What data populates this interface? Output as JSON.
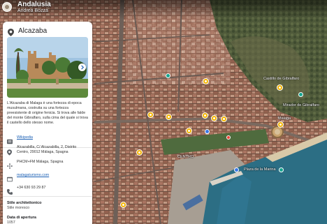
{
  "header": {
    "title": "Andalusia",
    "subtitle": "Andrea Bozza"
  },
  "panel": {
    "place_icon": "location-pin-icon",
    "title": "Alcazaba",
    "description": "L'Alcazaba di Malaga è una fortezza di epoca musulmana, costruita su una fortezza preesistente di origine fenicia. Si trova alle falde del monte Gibralfaro, sulla cima del quale si trova il castello dello stesso nome.",
    "wikipedia_label": "Wikipedia",
    "address": "Alcazabilla, C/ Alcazabilla, 2, Distrito Centro, 29012 Málaga, Spagna",
    "plus_code": "PHCM+FM Málaga, Spagna",
    "website": "malagaturismo.com",
    "phone": "+34 630 93 29 87",
    "style_label": "Stile architettonico",
    "style_value": "Stile moresco",
    "opening_label": "Data di apertura",
    "opening_value": "1057"
  },
  "map": {
    "labels": {
      "castillo": "Castillo de Gibralfaro",
      "mirador": "Mirador de Gibralfaro",
      "centro": "CENTRO",
      "plaza": "Plaza de la Marina",
      "malaga_port": "Málaga"
    },
    "colors": {
      "pin": "#f4b400",
      "green_pin": "#15a58f",
      "sea": "#2c6e84"
    }
  }
}
